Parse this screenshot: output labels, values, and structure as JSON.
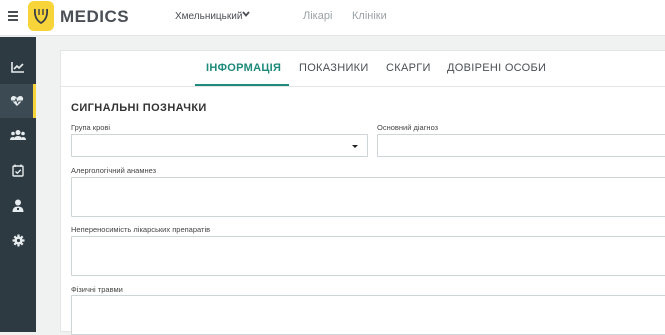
{
  "header": {
    "brand": "MEDICS",
    "city": "Хмельницький",
    "nav": [
      "Лікарі",
      "Клініки"
    ]
  },
  "sidebar": {
    "items": [
      {
        "icon": "chart-line-icon",
        "active": false
      },
      {
        "icon": "heartbeat-icon",
        "active": true
      },
      {
        "icon": "users-icon",
        "active": false
      },
      {
        "icon": "calendar-check-icon",
        "active": false
      },
      {
        "icon": "user-doctor-icon",
        "active": false
      },
      {
        "icon": "gear-icon",
        "active": false
      }
    ]
  },
  "tabs": [
    {
      "label": "ІНФОРМАЦІЯ",
      "active": true
    },
    {
      "label": "ПОКАЗНИКИ",
      "active": false
    },
    {
      "label": "СКАРГИ",
      "active": false
    },
    {
      "label": "ДОВІРЕНІ ОСОБИ",
      "active": false
    }
  ],
  "form": {
    "section_title": "СИГНАЛЬНІ ПОЗНАЧКИ",
    "blood_group_label": "Група крові",
    "blood_group_value": "",
    "main_diagnosis_label": "Основний діагноз",
    "main_diagnosis_value": "",
    "allergy_label": "Алергологічний анамнез",
    "allergy_value": "",
    "drug_intolerance_label": "Непереносимість лікарських препаратів",
    "drug_intolerance_value": "",
    "injuries_label": "Фізичні травми",
    "injuries_value": ""
  },
  "colors": {
    "accent": "#1d8a7b",
    "brand_yellow": "#f7d53a",
    "sidebar_bg": "#2d3a42"
  }
}
